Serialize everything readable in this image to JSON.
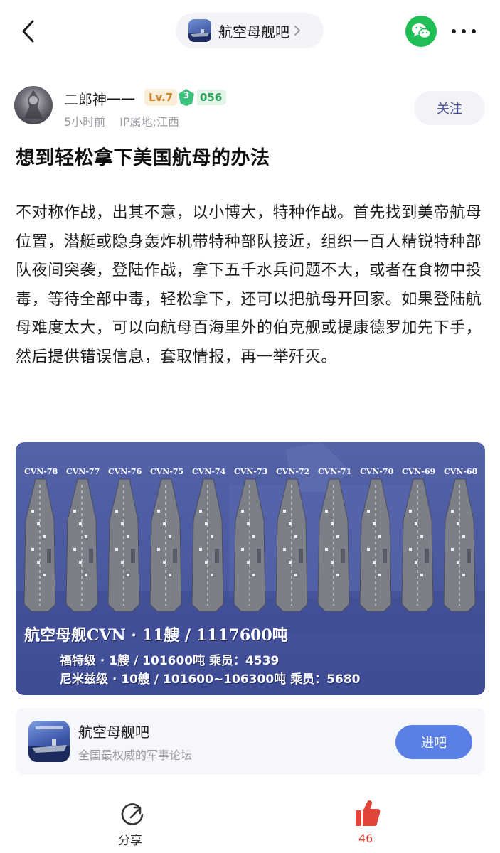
{
  "topbar": {
    "forum_name": "航空母舰吧",
    "icons": [
      "back-arrow-icon",
      "chevron-right-icon",
      "wechat-icon",
      "more-icon"
    ]
  },
  "author": {
    "name": "二郎神一一",
    "level": "Lv.7",
    "gem_level": "3",
    "score": "056",
    "time": "5小时前",
    "ip": "IP属地:江西",
    "follow_label": "关注"
  },
  "post": {
    "title": "想到轻松拿下美国航母的办法",
    "body": "不对称作战，出其不意，以小博大，特种作战。首先找到美帝航母位置，潜艇或隐身轰炸机带特种部队接近，组织一百人精锐特种部队夜间突袭，登陆作战，拿下五千水兵问题不大，或者在食物中投毒，等待全部中毒，轻松拿下，还可以把航母开回家。如果登陆航母难度太大，可以向航母百海里外的伯克舰或提康德罗加先下手，然后提供错误信息，套取情报，再一举歼灭。"
  },
  "image": {
    "ship_labels": [
      "CVN-78",
      "CVN-77",
      "CVN-76",
      "CVN-75",
      "CVN-74",
      "CVN-73",
      "CVN-72",
      "CVN-71",
      "CVN-70",
      "CVN-69",
      "CVN-68"
    ],
    "caption_main": "航空母舰CVN · 11艘 / 1117600吨",
    "caption_line1": "福特级 · 1艘 / 101600吨 乘员：4539",
    "caption_line2": "尼米兹级 · 10艘 / 101600~106300吨 乘员：5680",
    "colors": {
      "background": "#4a58a0",
      "deck": "#7c7f88"
    }
  },
  "forum_card": {
    "name": "航空母舰吧",
    "description": "全国最权威的军事论坛",
    "enter_label": "进吧"
  },
  "bottom": {
    "share_label": "分享",
    "like_count": "46",
    "accent": "#e0453a"
  }
}
